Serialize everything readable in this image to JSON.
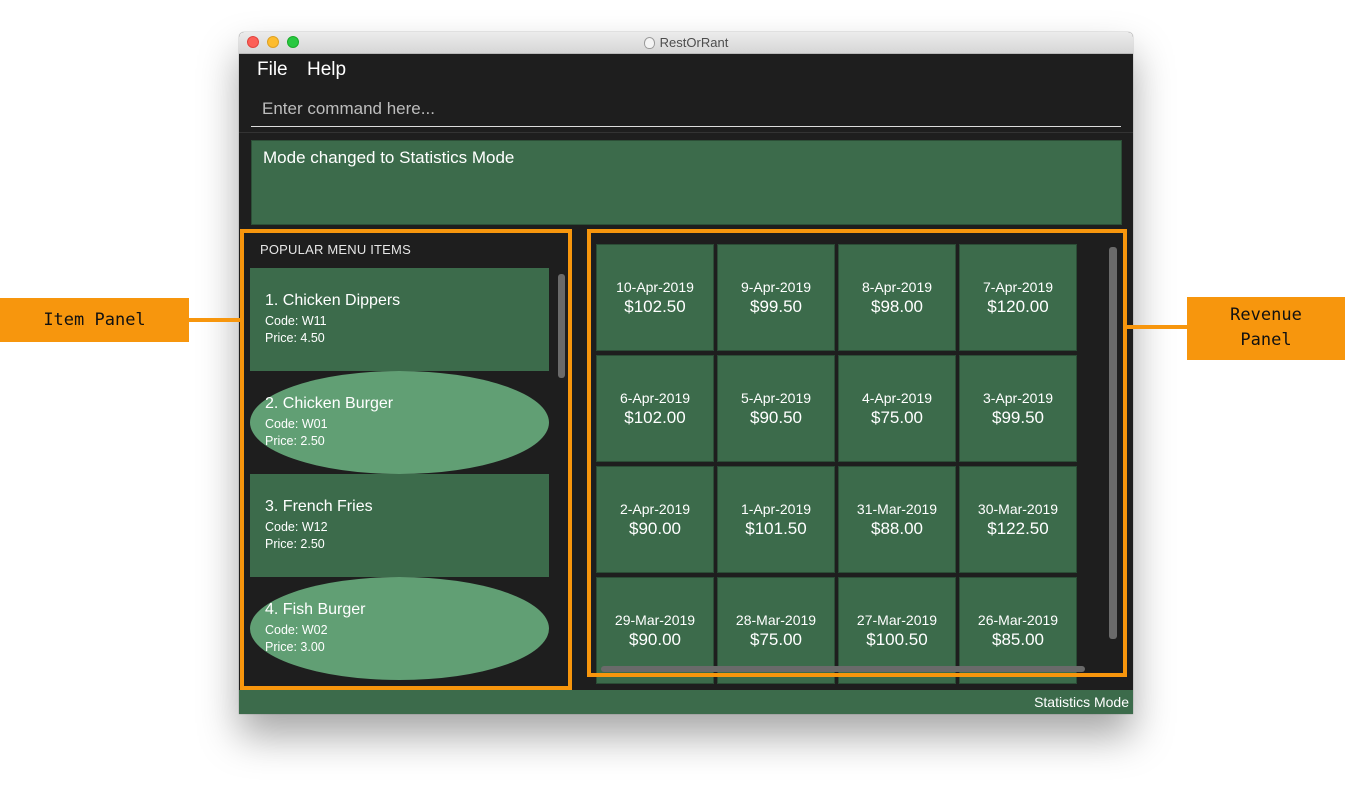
{
  "window": {
    "title": "RestOrRant"
  },
  "menu": {
    "file": "File",
    "help": "Help"
  },
  "command": {
    "placeholder": "Enter command here..."
  },
  "result": {
    "text": "Mode changed to Statistics Mode"
  },
  "item_panel": {
    "header": "POPULAR MENU ITEMS",
    "items": [
      {
        "name": "1.  Chicken Dippers",
        "code": "Code: W11",
        "price": "Price: 4.50"
      },
      {
        "name": "2.  Chicken Burger",
        "code": "Code: W01",
        "price": "Price: 2.50"
      },
      {
        "name": "3.  French Fries",
        "code": "Code: W12",
        "price": "Price: 2.50"
      },
      {
        "name": "4.  Fish Burger",
        "code": "Code: W02",
        "price": "Price: 3.00"
      }
    ]
  },
  "revenue_panel": {
    "cards": [
      {
        "date": "10-Apr-2019",
        "amount": "$102.50"
      },
      {
        "date": "9-Apr-2019",
        "amount": "$99.50"
      },
      {
        "date": "8-Apr-2019",
        "amount": "$98.00"
      },
      {
        "date": "7-Apr-2019",
        "amount": "$120.00"
      },
      {
        "date": "6-Apr-2019",
        "amount": "$102.00"
      },
      {
        "date": "5-Apr-2019",
        "amount": "$90.50"
      },
      {
        "date": "4-Apr-2019",
        "amount": "$75.00"
      },
      {
        "date": "3-Apr-2019",
        "amount": "$99.50"
      },
      {
        "date": "2-Apr-2019",
        "amount": "$90.00"
      },
      {
        "date": "1-Apr-2019",
        "amount": "$101.50"
      },
      {
        "date": "31-Mar-2019",
        "amount": "$88.00"
      },
      {
        "date": "30-Mar-2019",
        "amount": "$122.50"
      },
      {
        "date": "29-Mar-2019",
        "amount": "$90.00"
      },
      {
        "date": "28-Mar-2019",
        "amount": "$75.00"
      },
      {
        "date": "27-Mar-2019",
        "amount": "$100.50"
      },
      {
        "date": "26-Mar-2019",
        "amount": "$85.00"
      }
    ]
  },
  "status": {
    "mode": "Statistics Mode"
  },
  "annotations": {
    "item_panel": "Item Panel",
    "revenue_panel_line1": "Revenue",
    "revenue_panel_line2": "Panel"
  },
  "colors": {
    "card_dark": "#3c6b4b",
    "card_light": "#619f74",
    "highlight": "#f7960d",
    "background": "#1e1e1e"
  }
}
